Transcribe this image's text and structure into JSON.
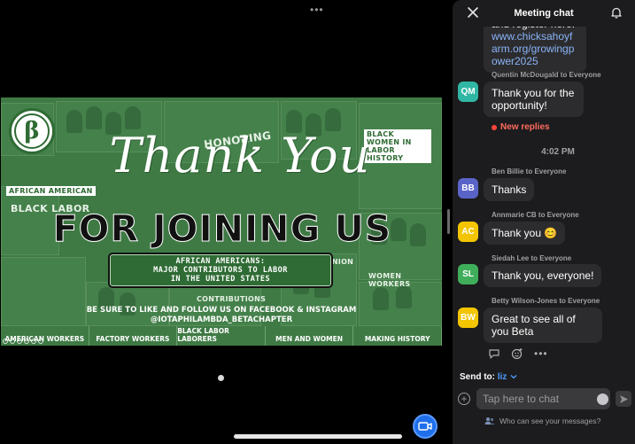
{
  "stage": {
    "more_icon": "more-horizontal-icon",
    "slide": {
      "logo_symbol": "β",
      "logo_ring_text": "IOTA PHI LAMBDA SORORITY, INC.",
      "headline_script": "Thank You",
      "headline_main": "FOR JOINING US",
      "subject_lines": [
        "AFRICAN AMERICANS:",
        "MAJOR CONTRIBUTORS TO LABOR",
        "IN THE UNITED STATES"
      ],
      "follow_line1": "BE SURE TO LIKE AND FOLLOW US ON FACEBOOK & INSTAGRAM",
      "follow_line2": "@IOTAPHILAMBDA_BETACHAPTER",
      "tile_labels": {
        "african_american": "AFRICAN AMERICAN",
        "black_labor": "BLACK LABOR",
        "honoring": "HONORING",
        "contributions": "CONTRIBUTIONS",
        "black_women": "BLACK WOMEN IN LABOR HISTORY",
        "union": "UNION",
        "women_workers": "WOMEN WORKERS"
      },
      "bottom_strip": [
        "AMERICAN WORKERS",
        "FACTORY WORKERS",
        "BLACK LABOR LABORERS",
        "MEN AND WOMEN",
        "MAKING HISTORY"
      ]
    }
  },
  "chat": {
    "title": "Meeting chat",
    "close_icon": "close-icon",
    "bell_icon": "bell-icon",
    "partial_text": "and register here:",
    "partial_link": "www.chicksahoyfarm.org/growingpower2025",
    "messages": [
      {
        "sender": "Quentin McDougald to Everyone",
        "initials": "QM",
        "color": "#2fb7a4",
        "text": "Thank you for the opportunity!"
      },
      {
        "sender": "Ben Billie to Everyone",
        "initials": "BB",
        "color": "#5a64c8",
        "text": "Thanks"
      },
      {
        "sender": "Annmarie CB to Everyone",
        "initials": "AC",
        "color": "#f2c500",
        "text": "Thank you 😊"
      },
      {
        "sender": "Siedah Lee to Everyone",
        "initials": "SL",
        "color": "#3fae5a",
        "text": "Thank you, everyone!"
      },
      {
        "sender": "Betty Wilson-Jones to Everyone",
        "initials": "BW",
        "color": "#f2c500",
        "text": "Great to see all of you Beta"
      }
    ],
    "new_replies": "New replies",
    "time_separator": "4:02 PM",
    "send_to_label": "Send to:",
    "send_to_target": "liz",
    "input_placeholder": "Tap here to chat",
    "who_can_see": "Who can see your messages?"
  }
}
